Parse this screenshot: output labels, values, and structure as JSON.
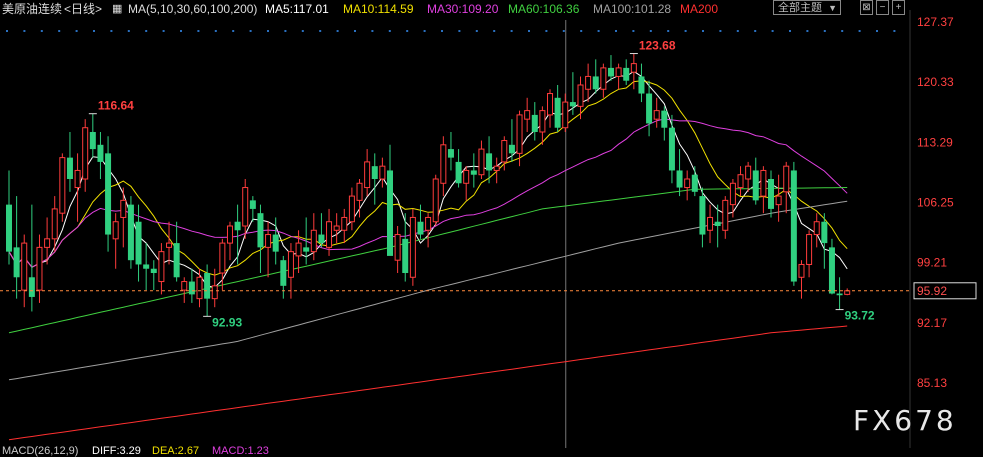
{
  "header": {
    "title": "美原油连续",
    "timeframe": "<日线>",
    "ma_params": "MA(5,10,30,60,100,200)",
    "ma_values": [
      {
        "label": "MA5:117.01",
        "color": "#ffffff"
      },
      {
        "label": "MA10:114.59",
        "color": "#f0e000"
      },
      {
        "label": "MA30:109.20",
        "color": "#e040e0"
      },
      {
        "label": "MA60:106.36",
        "color": "#40d040"
      },
      {
        "label": "MA100:101.28",
        "color": "#a0a0a0"
      },
      {
        "label": "MA200",
        "color": "#ff3030"
      }
    ],
    "theme_label": "全部主题",
    "window_controls": [
      "⊠",
      "−",
      "+"
    ]
  },
  "footer": {
    "items": [
      {
        "label": "MACD(26,12,9)",
        "color": "#cccccc"
      },
      {
        "label": "DIFF:3.29",
        "color": "#ffffff"
      },
      {
        "label": "DEA:2.67",
        "color": "#f0e000"
      },
      {
        "label": "MACD:1.23",
        "color": "#e040e0"
      }
    ]
  },
  "watermark": "FX678",
  "colors": {
    "up": "#ff3c3c",
    "down": "#30d080",
    "grid_dot": "#2a70c0",
    "last_price_line": "#ff8a3d"
  },
  "chart_data": {
    "type": "candlestick",
    "ylim": [
      81.6,
      127.37
    ],
    "y_ticks": [
      "127.37",
      "120.33",
      "113.29",
      "106.25",
      "99.21",
      "92.17",
      "85.13"
    ],
    "last_price": "95.92",
    "annotations": [
      {
        "text": "116.64",
        "index": 11,
        "value": 116.64,
        "kind": "high"
      },
      {
        "text": "92.93",
        "index": 26,
        "value": 92.93,
        "kind": "low"
      },
      {
        "text": "123.68",
        "index": 82,
        "value": 123.68,
        "kind": "high"
      },
      {
        "text": "93.72",
        "index": 109,
        "value": 93.72,
        "kind": "low"
      }
    ],
    "crosshair_index": 73,
    "ohlc": [
      [
        106.0,
        110.0,
        99.0,
        100.5
      ],
      [
        101.0,
        107.0,
        95.0,
        97.5
      ],
      [
        96.0,
        102.5,
        94.0,
        101.5
      ],
      [
        97.5,
        106.0,
        93.5,
        95.2
      ],
      [
        96.0,
        102.5,
        94.5,
        101.0
      ],
      [
        101.0,
        104.5,
        99.0,
        102.0
      ],
      [
        102.0,
        107.0,
        100.5,
        105.5
      ],
      [
        105.0,
        112.0,
        104.0,
        111.5
      ],
      [
        111.5,
        114.5,
        107.5,
        109.0
      ],
      [
        108.0,
        112.0,
        104.0,
        110.0
      ],
      [
        109.0,
        116.0,
        107.5,
        115.0
      ],
      [
        114.5,
        116.64,
        111.5,
        112.5
      ],
      [
        113.0,
        114.5,
        109.0,
        111.0
      ],
      [
        112.0,
        114.0,
        100.5,
        102.5
      ],
      [
        102.0,
        105.0,
        98.5,
        104.0
      ],
      [
        104.5,
        108.0,
        101.0,
        106.5
      ],
      [
        106.0,
        107.0,
        98.5,
        99.5
      ],
      [
        104.0,
        106.0,
        97.0,
        99.0
      ],
      [
        99.0,
        101.5,
        96.0,
        98.5
      ],
      [
        98.5,
        99.5,
        96.0,
        98.0
      ],
      [
        97.0,
        101.5,
        95.5,
        100.5
      ],
      [
        101.0,
        104.0,
        99.0,
        101.5
      ],
      [
        101.5,
        104.0,
        97.0,
        97.5
      ],
      [
        96.0,
        97.5,
        94.5,
        97.0
      ],
      [
        97.0,
        98.5,
        94.5,
        95.5
      ],
      [
        95.0,
        98.5,
        94.0,
        97.5
      ],
      [
        98.0,
        99.0,
        92.93,
        95.0
      ],
      [
        95.0,
        98.5,
        94.0,
        96.5
      ],
      [
        98.0,
        102.0,
        96.0,
        101.5
      ],
      [
        101.5,
        104.0,
        99.5,
        103.5
      ],
      [
        104.0,
        106.0,
        99.0,
        103.0
      ],
      [
        103.5,
        109.0,
        102.0,
        108.0
      ],
      [
        106.5,
        107.0,
        104.0,
        105.5
      ],
      [
        105.0,
        106.0,
        98.0,
        101.0
      ],
      [
        101.0,
        104.0,
        97.5,
        102.5
      ],
      [
        102.5,
        104.5,
        99.0,
        100.5
      ],
      [
        99.5,
        100.0,
        95.0,
        96.5
      ],
      [
        97.5,
        101.5,
        95.0,
        100.5
      ],
      [
        100.0,
        103.0,
        98.0,
        101.5
      ],
      [
        101.0,
        104.5,
        99.0,
        100.5
      ],
      [
        100.5,
        105.0,
        99.5,
        103.0
      ],
      [
        102.5,
        105.0,
        101.0,
        101.5
      ],
      [
        101.0,
        105.5,
        100.0,
        104.0
      ],
      [
        103.0,
        105.0,
        101.5,
        103.5
      ],
      [
        103.0,
        105.5,
        101.5,
        104.5
      ],
      [
        104.0,
        108.0,
        103.0,
        107.0
      ],
      [
        106.5,
        109.0,
        104.5,
        108.5
      ],
      [
        108.0,
        112.5,
        107.0,
        111.0
      ],
      [
        110.5,
        112.0,
        106.0,
        109.0
      ],
      [
        109.0,
        111.5,
        108.0,
        110.5
      ],
      [
        110.0,
        113.0,
        103.5,
        100.0
      ],
      [
        99.5,
        103.5,
        98.0,
        102.5
      ],
      [
        102.0,
        105.0,
        97.0,
        98.0
      ],
      [
        97.5,
        105.5,
        96.5,
        104.5
      ],
      [
        104.0,
        106.0,
        102.0,
        102.5
      ],
      [
        103.0,
        105.0,
        101.0,
        104.5
      ],
      [
        104.0,
        109.5,
        103.5,
        109.0
      ],
      [
        108.5,
        114.0,
        107.0,
        113.0
      ],
      [
        112.5,
        114.5,
        110.0,
        111.5
      ],
      [
        111.0,
        112.5,
        108.0,
        108.5
      ],
      [
        108.5,
        110.5,
        106.5,
        110.0
      ],
      [
        110.0,
        112.0,
        108.0,
        109.5
      ],
      [
        109.5,
        113.5,
        109.0,
        112.5
      ],
      [
        112.0,
        114.0,
        108.5,
        110.0
      ],
      [
        110.0,
        111.5,
        108.5,
        110.5
      ],
      [
        111.0,
        114.0,
        110.0,
        113.5
      ],
      [
        113.0,
        116.0,
        111.0,
        112.0
      ],
      [
        112.0,
        117.0,
        110.5,
        116.5
      ],
      [
        116.0,
        118.5,
        114.5,
        117.0
      ],
      [
        116.5,
        118.0,
        113.5,
        114.5
      ],
      [
        114.5,
        117.5,
        113.0,
        117.0
      ],
      [
        116.5,
        119.5,
        115.0,
        119.0
      ],
      [
        118.5,
        120.0,
        114.5,
        115.0
      ],
      [
        115.0,
        119.0,
        114.5,
        118.0
      ],
      [
        118.0,
        121.5,
        116.5,
        117.5
      ],
      [
        117.5,
        121.0,
        116.0,
        120.0
      ],
      [
        119.5,
        122.5,
        118.0,
        121.0
      ],
      [
        121.0,
        123.0,
        119.0,
        119.5
      ],
      [
        119.5,
        122.5,
        118.5,
        122.0
      ],
      [
        122.0,
        123.5,
        120.5,
        121.0
      ],
      [
        121.0,
        122.5,
        119.5,
        122.0
      ],
      [
        122.0,
        123.0,
        120.0,
        120.5
      ],
      [
        121.5,
        123.68,
        119.5,
        122.5
      ],
      [
        121.0,
        122.5,
        118.0,
        119.0
      ],
      [
        119.0,
        120.5,
        114.0,
        115.5
      ],
      [
        116.0,
        118.5,
        115.0,
        117.0
      ],
      [
        117.0,
        117.5,
        113.5,
        115.0
      ],
      [
        115.0,
        116.5,
        108.5,
        110.0
      ],
      [
        110.0,
        112.5,
        107.0,
        108.0
      ],
      [
        108.0,
        110.0,
        106.5,
        109.0
      ],
      [
        109.5,
        110.5,
        107.0,
        107.5
      ],
      [
        107.0,
        108.0,
        101.0,
        102.5
      ],
      [
        103.0,
        106.0,
        101.5,
        104.5
      ],
      [
        104.0,
        106.0,
        101.0,
        103.5
      ],
      [
        103.0,
        107.0,
        102.0,
        106.5
      ],
      [
        106.0,
        109.0,
        104.5,
        108.5
      ],
      [
        108.0,
        110.5,
        107.0,
        109.5
      ],
      [
        109.0,
        111.0,
        107.5,
        110.5
      ],
      [
        110.0,
        111.5,
        106.0,
        106.5
      ],
      [
        107.0,
        110.5,
        105.0,
        110.0
      ],
      [
        109.0,
        110.0,
        104.5,
        105.5
      ],
      [
        106.0,
        109.5,
        104.0,
        107.0
      ],
      [
        107.5,
        111.0,
        105.0,
        110.5
      ],
      [
        110.0,
        111.0,
        96.5,
        97.0
      ],
      [
        97.5,
        99.5,
        95.0,
        99.0
      ],
      [
        99.0,
        103.0,
        97.5,
        102.5
      ],
      [
        102.5,
        105.0,
        101.0,
        104.0
      ],
      [
        104.0,
        105.0,
        98.5,
        101.5
      ],
      [
        101.0,
        102.0,
        95.5,
        95.6
      ],
      [
        95.6,
        97.5,
        93.72,
        95.4
      ],
      [
        95.5,
        96.2,
        95.4,
        95.92
      ]
    ],
    "ma_series": [
      {
        "name": "MA5",
        "color": "#ffffff"
      },
      {
        "name": "MA10",
        "color": "#f0e000"
      },
      {
        "name": "MA30",
        "color": "#e040e0"
      },
      {
        "name": "MA60",
        "color": "#40d040"
      },
      {
        "name": "MA100",
        "color": "#a0a0a0"
      },
      {
        "name": "MA200",
        "color": "#ff3030"
      }
    ],
    "long_ma_anchors": {
      "MA60": [
        [
          0,
          91.0
        ],
        [
          25,
          96.0
        ],
        [
          50,
          101.0
        ],
        [
          70,
          105.5
        ],
        [
          90,
          107.8
        ],
        [
          110,
          108.0
        ]
      ],
      "MA100": [
        [
          0,
          85.5
        ],
        [
          30,
          90.0
        ],
        [
          55,
          96.0
        ],
        [
          80,
          101.5
        ],
        [
          100,
          105.0
        ],
        [
          110,
          106.4
        ]
      ],
      "MA200": [
        [
          0,
          78.5
        ],
        [
          40,
          83.5
        ],
        [
          80,
          88.5
        ],
        [
          100,
          91.0
        ],
        [
          110,
          91.8
        ]
      ]
    }
  }
}
